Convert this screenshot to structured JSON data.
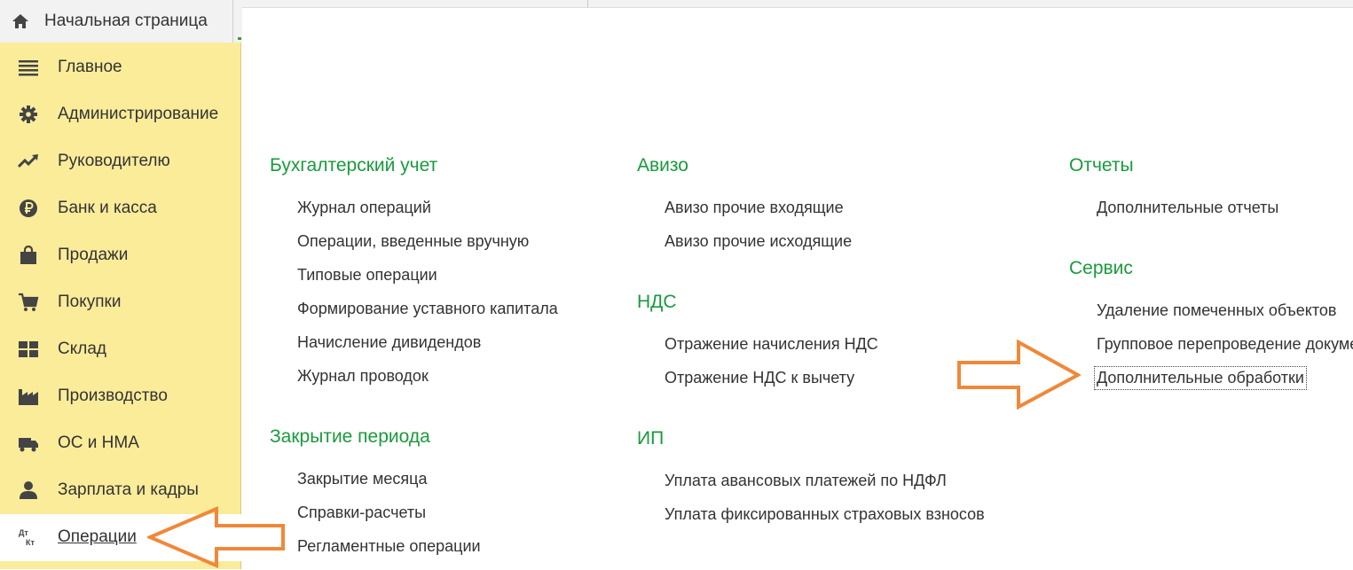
{
  "home_tab": {
    "label": "Начальная страница",
    "icon": "home-icon"
  },
  "sidebar": {
    "items": [
      {
        "label": "Главное",
        "icon": "menu-lines-icon"
      },
      {
        "label": "Администрирование",
        "icon": "gear-icon"
      },
      {
        "label": "Руководителю",
        "icon": "trend-up-icon"
      },
      {
        "label": "Банк и касса",
        "icon": "ruble-icon"
      },
      {
        "label": "Продажи",
        "icon": "shopping-bag-icon"
      },
      {
        "label": "Покупки",
        "icon": "cart-icon"
      },
      {
        "label": "Склад",
        "icon": "warehouse-grid-icon"
      },
      {
        "label": "Производство",
        "icon": "factory-icon"
      },
      {
        "label": "ОС и НМА",
        "icon": "truck-icon"
      },
      {
        "label": "Зарплата и кадры",
        "icon": "person-icon"
      },
      {
        "label": "Операции",
        "icon": "dt-kt-icon",
        "active": true
      }
    ]
  },
  "content": {
    "col1": [
      {
        "title": "Бухгалтерский учет",
        "links": [
          "Журнал операций",
          "Операции, введенные вручную",
          "Типовые операции",
          "Формирование уставного капитала",
          "Начисление дивидендов",
          "Журнал проводок"
        ]
      },
      {
        "title": "Закрытие периода",
        "links": [
          "Закрытие месяца",
          "Справки-расчеты",
          "Регламентные операции"
        ]
      }
    ],
    "col2": [
      {
        "title": "Авизо",
        "links": [
          "Авизо прочие входящие",
          "Авизо прочие исходящие"
        ]
      },
      {
        "title": "НДС",
        "links": [
          "Отражение начисления НДС",
          "Отражение НДС к вычету"
        ]
      },
      {
        "title": "ИП",
        "links": [
          "Уплата авансовых платежей по НДФЛ",
          "Уплата фиксированных страховых взносов"
        ]
      }
    ],
    "col3": [
      {
        "title": "Отчеты",
        "links": [
          "Дополнительные отчеты"
        ]
      },
      {
        "title": "Сервис",
        "links": [
          "Удаление помеченных объектов",
          "Групповое перепроведение документов",
          "Дополнительные обработки"
        ]
      }
    ]
  },
  "annotations": {
    "arrow_color": "#f0883a"
  }
}
